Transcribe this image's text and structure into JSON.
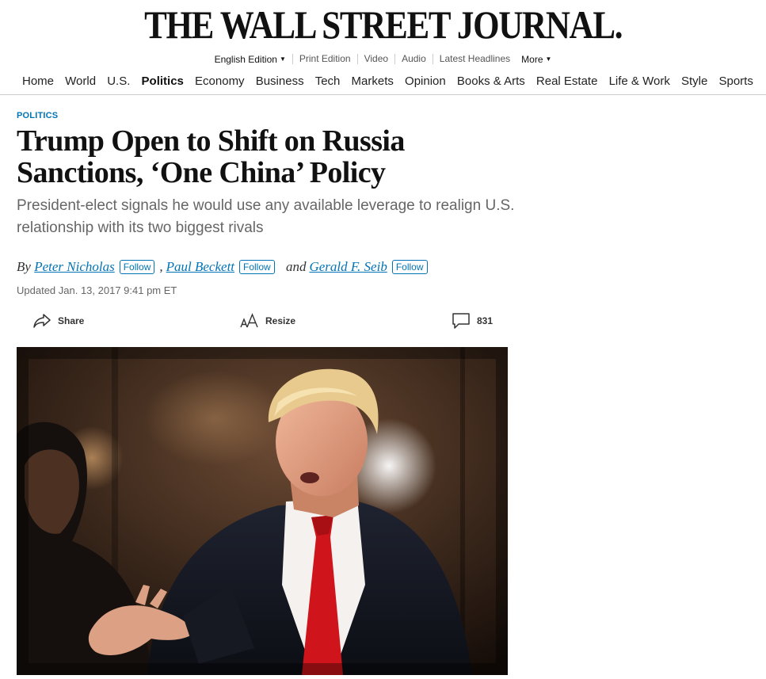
{
  "masthead": {
    "logo": "THE WALL STREET JOURNAL."
  },
  "edition_bar": {
    "items": [
      "English Edition",
      "Print Edition",
      "Video",
      "Audio",
      "Latest Headlines",
      "More"
    ]
  },
  "nav": {
    "items": [
      "Home",
      "World",
      "U.S.",
      "Politics",
      "Economy",
      "Business",
      "Tech",
      "Markets",
      "Opinion",
      "Books & Arts",
      "Real Estate",
      "Life & Work",
      "Style",
      "Sports"
    ],
    "active": "Politics"
  },
  "article": {
    "section_flag": "POLITICS",
    "headline": "Trump Open to Shift on Russia Sanctions, ‘One China’ Policy",
    "dek": "President-elect signals he would use any available leverage to realign U.S. relationship with its two biggest rivals",
    "byline": {
      "by": "By",
      "authors": [
        "Peter Nicholas",
        "Paul Beckett",
        "Gerald F. Seib"
      ],
      "comma": ",",
      "and": "and",
      "follow_label": "Follow"
    },
    "timestamp": "Updated Jan. 13, 2017 9:41 pm ET"
  },
  "tools": {
    "share_label": "Share",
    "resize_label": "Resize",
    "comment_count": "831"
  },
  "colors": {
    "link_blue": "#0274b6",
    "tie_red": "#d0141b"
  },
  "icons": [
    "share-icon",
    "resize-icon",
    "comment-icon",
    "caret-down-icon"
  ]
}
